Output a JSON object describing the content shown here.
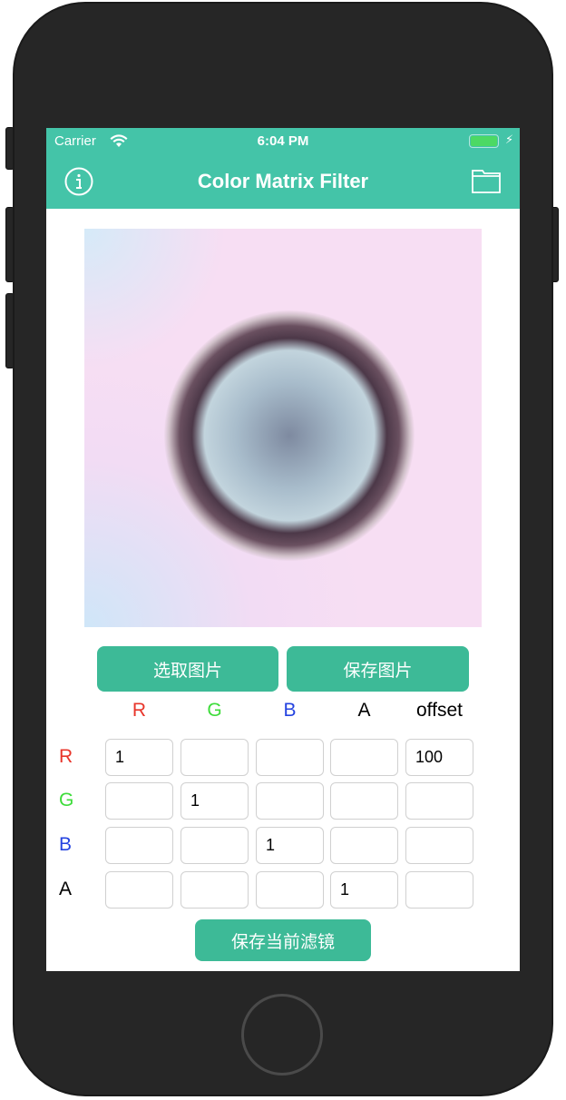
{
  "status": {
    "carrier": "Carrier",
    "time": "6:04 PM"
  },
  "nav": {
    "title": "Color Matrix Filter",
    "left_icon": "info-icon",
    "right_icon": "folder-icon"
  },
  "buttons": {
    "pick": "选取图片",
    "save_image": "保存图片",
    "save_filter": "保存当前滤镜"
  },
  "matrix": {
    "columns": [
      {
        "label": "R",
        "color": "#e8352a"
      },
      {
        "label": "G",
        "color": "#3ddc3a"
      },
      {
        "label": "B",
        "color": "#2443e0"
      },
      {
        "label": "A",
        "color": "#000000"
      },
      {
        "label": "offset",
        "color": "#000000"
      }
    ],
    "rows": [
      {
        "label": "R",
        "color": "#e8352a",
        "values": [
          "1",
          "",
          "",
          "",
          "100"
        ]
      },
      {
        "label": "G",
        "color": "#3ddc3a",
        "values": [
          "",
          "1",
          "",
          "",
          ""
        ]
      },
      {
        "label": "B",
        "color": "#2443e0",
        "values": [
          "",
          "",
          "1",
          "",
          ""
        ]
      },
      {
        "label": "A",
        "color": "#000000",
        "values": [
          "",
          "",
          "",
          "1",
          ""
        ]
      }
    ]
  },
  "colors": {
    "header": "#44c4a8",
    "button": "#3dba97"
  }
}
